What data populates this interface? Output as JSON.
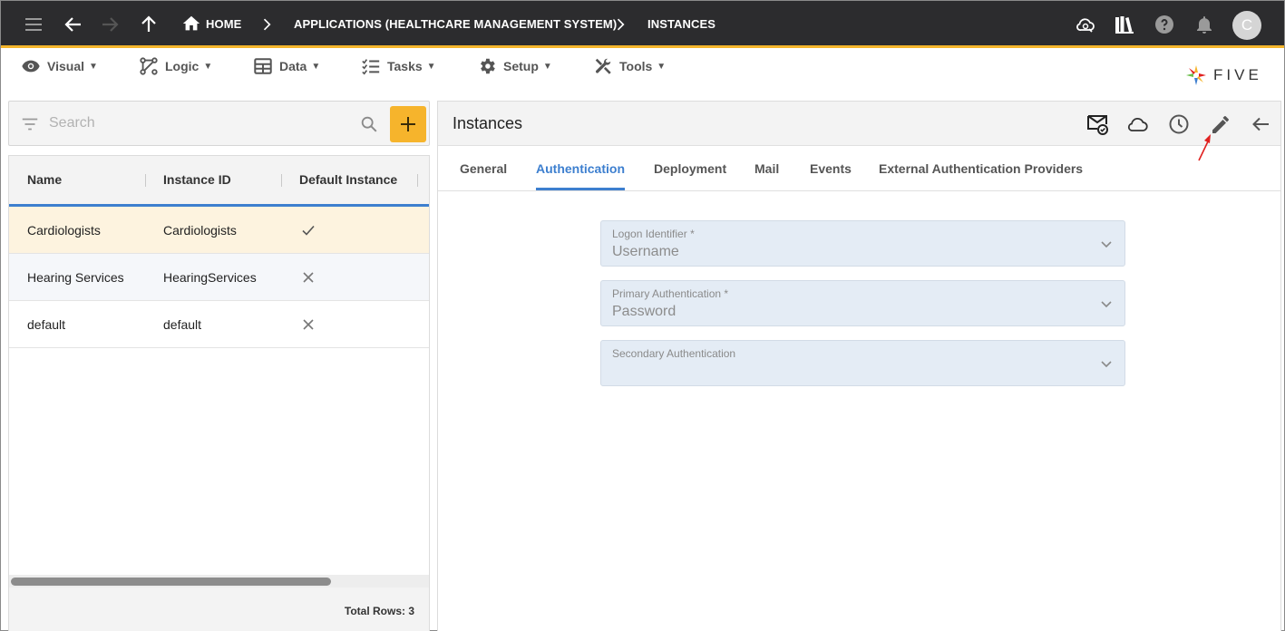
{
  "topbar": {
    "breadcrumbs": [
      "HOME",
      "APPLICATIONS (HEALTHCARE MANAGEMENT SYSTEM)",
      "INSTANCES"
    ],
    "avatar_initial": "C",
    "icons": [
      "menu-icon",
      "back-arrow-icon",
      "forward-arrow-icon",
      "up-arrow-icon",
      "home-icon",
      "cloud-sync-icon",
      "library-icon",
      "help-icon",
      "bell-icon"
    ]
  },
  "menubar": {
    "items": [
      {
        "label": "Visual",
        "icon": "eye-icon"
      },
      {
        "label": "Logic",
        "icon": "logic-icon"
      },
      {
        "label": "Data",
        "icon": "table-icon"
      },
      {
        "label": "Tasks",
        "icon": "checklist-icon"
      },
      {
        "label": "Setup",
        "icon": "gear-icon"
      },
      {
        "label": "Tools",
        "icon": "tools-icon"
      }
    ],
    "caret": "▼",
    "logo_text": "FIVE"
  },
  "left": {
    "search_placeholder": "Search",
    "columns": [
      "Name",
      "Instance ID",
      "Default Instance"
    ],
    "rows": [
      {
        "name": "Cardiologists",
        "instance_id": "Cardiologists",
        "default": true
      },
      {
        "name": "Hearing Services",
        "instance_id": "HearingServices",
        "default": false
      },
      {
        "name": "default",
        "instance_id": "default",
        "default": false
      }
    ],
    "total_rows_label": "Total Rows: 3"
  },
  "right": {
    "title": "Instances",
    "actions": [
      "mail-check-icon",
      "cloud-icon",
      "history-icon",
      "edit-pencil-icon",
      "back-arrow-icon"
    ],
    "tabs": [
      "General",
      "Authentication",
      "Deployment",
      "Mail",
      "Events",
      "External Authentication Providers"
    ],
    "active_tab": "Authentication",
    "fields": [
      {
        "label": "Logon Identifier *",
        "value": "Username"
      },
      {
        "label": "Primary Authentication *",
        "value": "Password"
      },
      {
        "label": "Secondary Authentication",
        "value": ""
      }
    ]
  },
  "colors": {
    "topbar_bg": "#2c2c2e",
    "accent_yellow": "#f6b42c",
    "accent_blue": "#3d7fcf",
    "selected_row": "#fdf3df",
    "field_bg": "#e4ecf5",
    "annotation_red": "#e0201f"
  }
}
